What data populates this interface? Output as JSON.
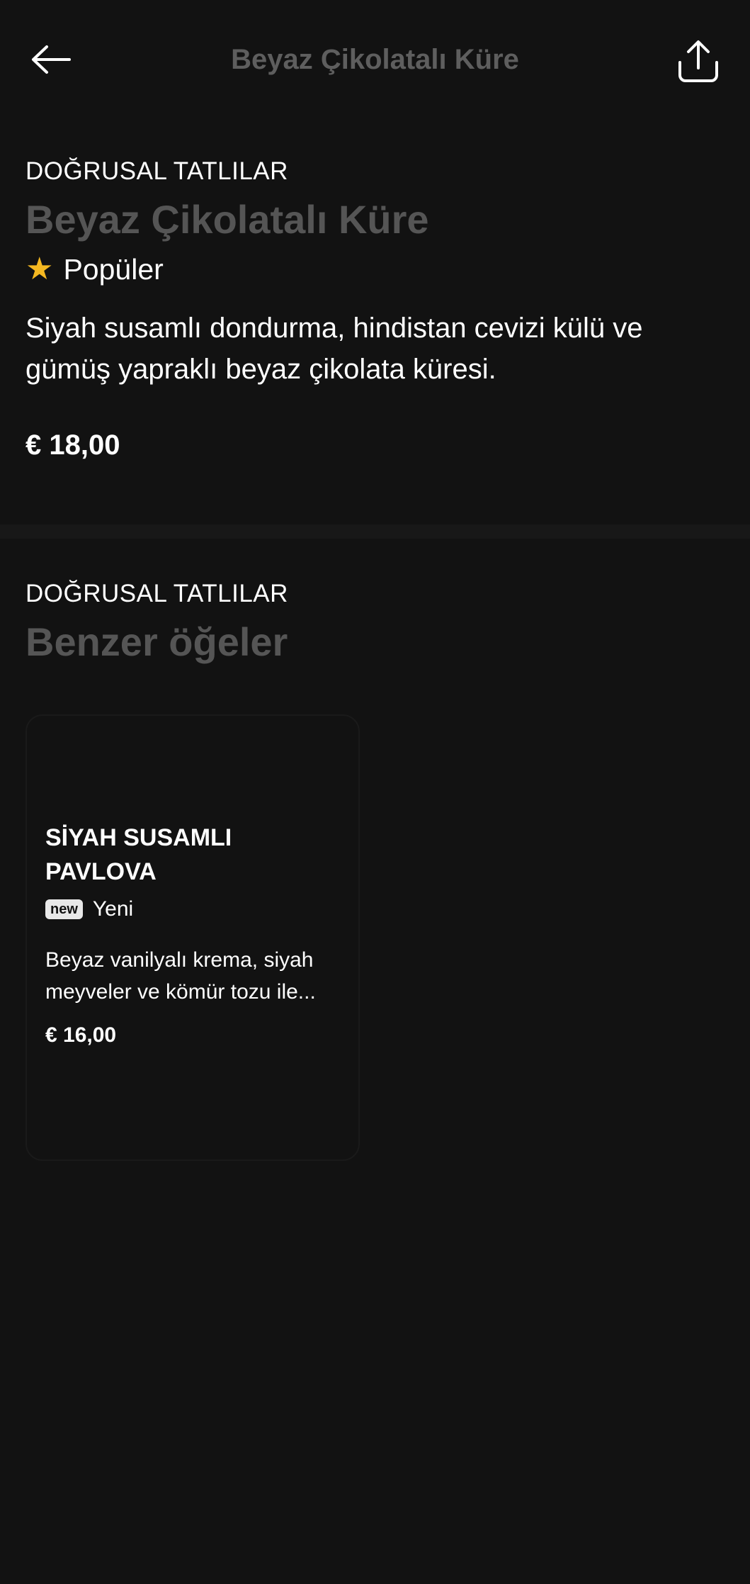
{
  "header": {
    "title": "Beyaz Çikolatalı Küre",
    "back_icon": "arrow-left-icon",
    "share_icon": "share-icon"
  },
  "product": {
    "category": "DOĞRUSAL TATLILAR",
    "name": "Beyaz Çikolatalı Küre",
    "badge": "Popüler",
    "badge_icon": "star-icon",
    "description": "Siyah susamlı dondurma, hindistan cevizi külü ve gümüş yapraklı beyaz çikolata küresi.",
    "price": "€ 18,00"
  },
  "similar": {
    "category": "DOĞRUSAL TATLILAR",
    "title": "Benzer öğeler",
    "items": [
      {
        "name": "SİYAH SUSAMLI PAVLOVA",
        "tag": "new",
        "tag_label": "Yeni",
        "description": "Beyaz vanilyalı krema, siyah meyveler ve kömür tozu ile...",
        "price": "€ 16,00"
      }
    ]
  },
  "colors": {
    "background": "#121212",
    "muted_title": "#555555",
    "star": "#f5b821"
  }
}
